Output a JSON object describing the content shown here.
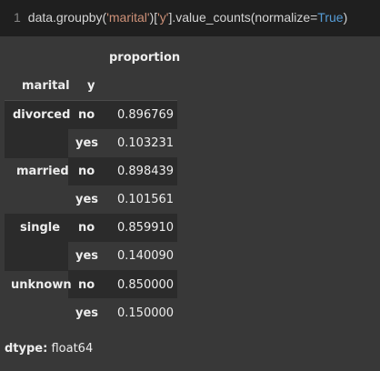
{
  "code": {
    "line_number": "1",
    "prefix": "data.groupby(",
    "str1": "'marital'",
    "mid": ")[",
    "str2": "'y'",
    "mid2": "].value_counts(normalize=",
    "kw": "True",
    "suffix": ")"
  },
  "table": {
    "col_header": "proportion",
    "index_names": [
      "marital",
      "y"
    ],
    "groups": [
      {
        "label": "divorced",
        "rows": [
          {
            "y": "no",
            "value": "0.896769"
          },
          {
            "y": "yes",
            "value": "0.103231"
          }
        ]
      },
      {
        "label": "married",
        "rows": [
          {
            "y": "no",
            "value": "0.898439"
          },
          {
            "y": "yes",
            "value": "0.101561"
          }
        ]
      },
      {
        "label": "single",
        "rows": [
          {
            "y": "no",
            "value": "0.859910"
          },
          {
            "y": "yes",
            "value": "0.140090"
          }
        ]
      },
      {
        "label": "unknown",
        "rows": [
          {
            "y": "no",
            "value": "0.850000"
          },
          {
            "y": "yes",
            "value": "0.150000"
          }
        ]
      }
    ]
  },
  "dtype": {
    "label": "dtype:",
    "value": "float64"
  }
}
